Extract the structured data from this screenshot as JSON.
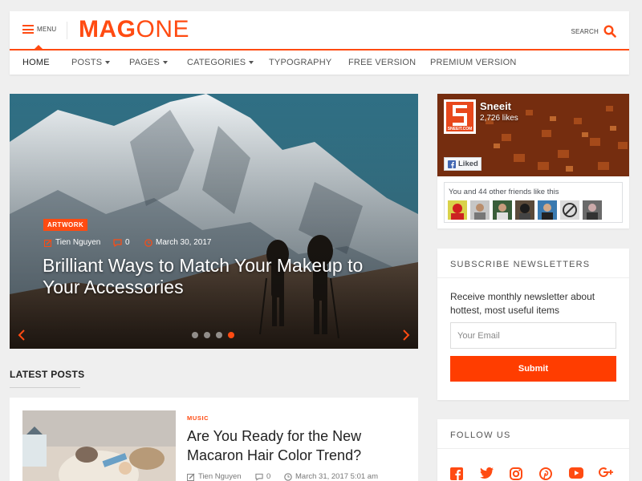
{
  "header": {
    "menu_label": "MENU",
    "logo_bold": "MAG",
    "logo_light": "ONE",
    "search_label": "SEARCH"
  },
  "nav": {
    "items": [
      {
        "label": "HOME",
        "dropdown": false,
        "active": true
      },
      {
        "label": "POSTS",
        "dropdown": true
      },
      {
        "label": "PAGES",
        "dropdown": true
      },
      {
        "label": "CATEGORIES",
        "dropdown": true
      },
      {
        "label": "TYPOGRAPHY",
        "dropdown": false
      },
      {
        "label": "FREE VERSION",
        "dropdown": false
      },
      {
        "label": "PREMIUM VERSION",
        "dropdown": false
      }
    ]
  },
  "hero": {
    "category": "ARTWORK",
    "author": "Tien Nguyen",
    "comments": "0",
    "date": "March 30, 2017",
    "title": "Brilliant Ways to Match Your Makeup to Your Accessories",
    "slide_count": 4,
    "active_slide": 4
  },
  "latest": {
    "heading": "LATEST POSTS",
    "post": {
      "category": "MUSIC",
      "title": "Are You Ready for the New Macaron Hair Color Trend?",
      "author": "Tien Nguyen",
      "comments": "0",
      "date": "March 31, 2017 5:01 am"
    }
  },
  "facebook": {
    "page_name": "Sneeit",
    "likes": "2,726 likes",
    "logo_text": "SNEEIT.COM",
    "liked_label": "Liked",
    "friends_text": "You and 44 other friends like this"
  },
  "newsletter": {
    "heading": "SUBSCRIBE NEWSLETTERS",
    "description": "Receive monthly newsletter about hottest, most useful items",
    "email_placeholder": "Your Email",
    "submit_label": "Submit"
  },
  "follow": {
    "heading": "FOLLOW US",
    "icons": [
      "facebook-icon",
      "twitter-icon",
      "instagram-icon",
      "pinterest-icon",
      "youtube-icon",
      "google-plus-icon"
    ]
  },
  "colors": {
    "accent": "#ff4b12",
    "facebook_blue": "#3b5998"
  }
}
